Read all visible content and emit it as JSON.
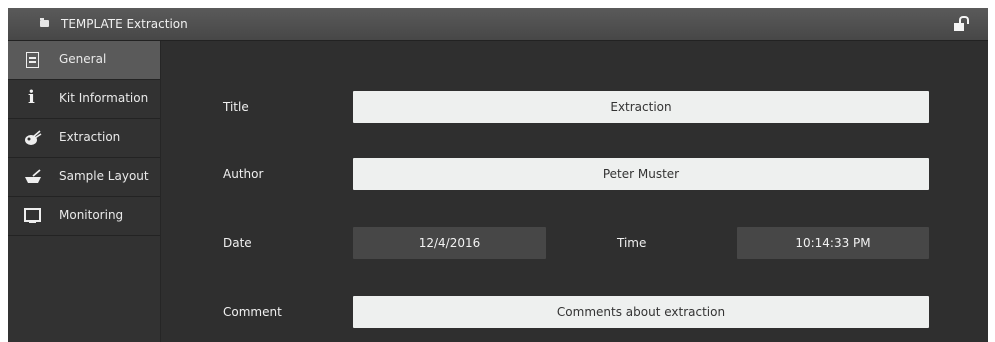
{
  "window": {
    "title": "TEMPLATE Extraction"
  },
  "sidebar": {
    "items": [
      {
        "label": "General",
        "icon": "document-icon",
        "active": true
      },
      {
        "label": "Kit Information",
        "icon": "info-icon"
      },
      {
        "label": "Extraction",
        "icon": "extraction-icon"
      },
      {
        "label": "Sample Layout",
        "icon": "sample-layout-icon"
      },
      {
        "label": "Monitoring",
        "icon": "monitor-icon"
      }
    ]
  },
  "form": {
    "title_label": "Title",
    "title_value": "Extraction",
    "author_label": "Author",
    "author_value": "Peter Muster",
    "date_label": "Date",
    "date_value": "12/4/2016",
    "time_label": "Time",
    "time_value": "10:14:33 PM",
    "comment_label": "Comment",
    "comment_value": "Comments about extraction"
  },
  "colors": {
    "background": "#2f2f2f",
    "active_item": "#5a5a5a",
    "field_light": "#eef0ef",
    "field_dark": "#474747"
  }
}
